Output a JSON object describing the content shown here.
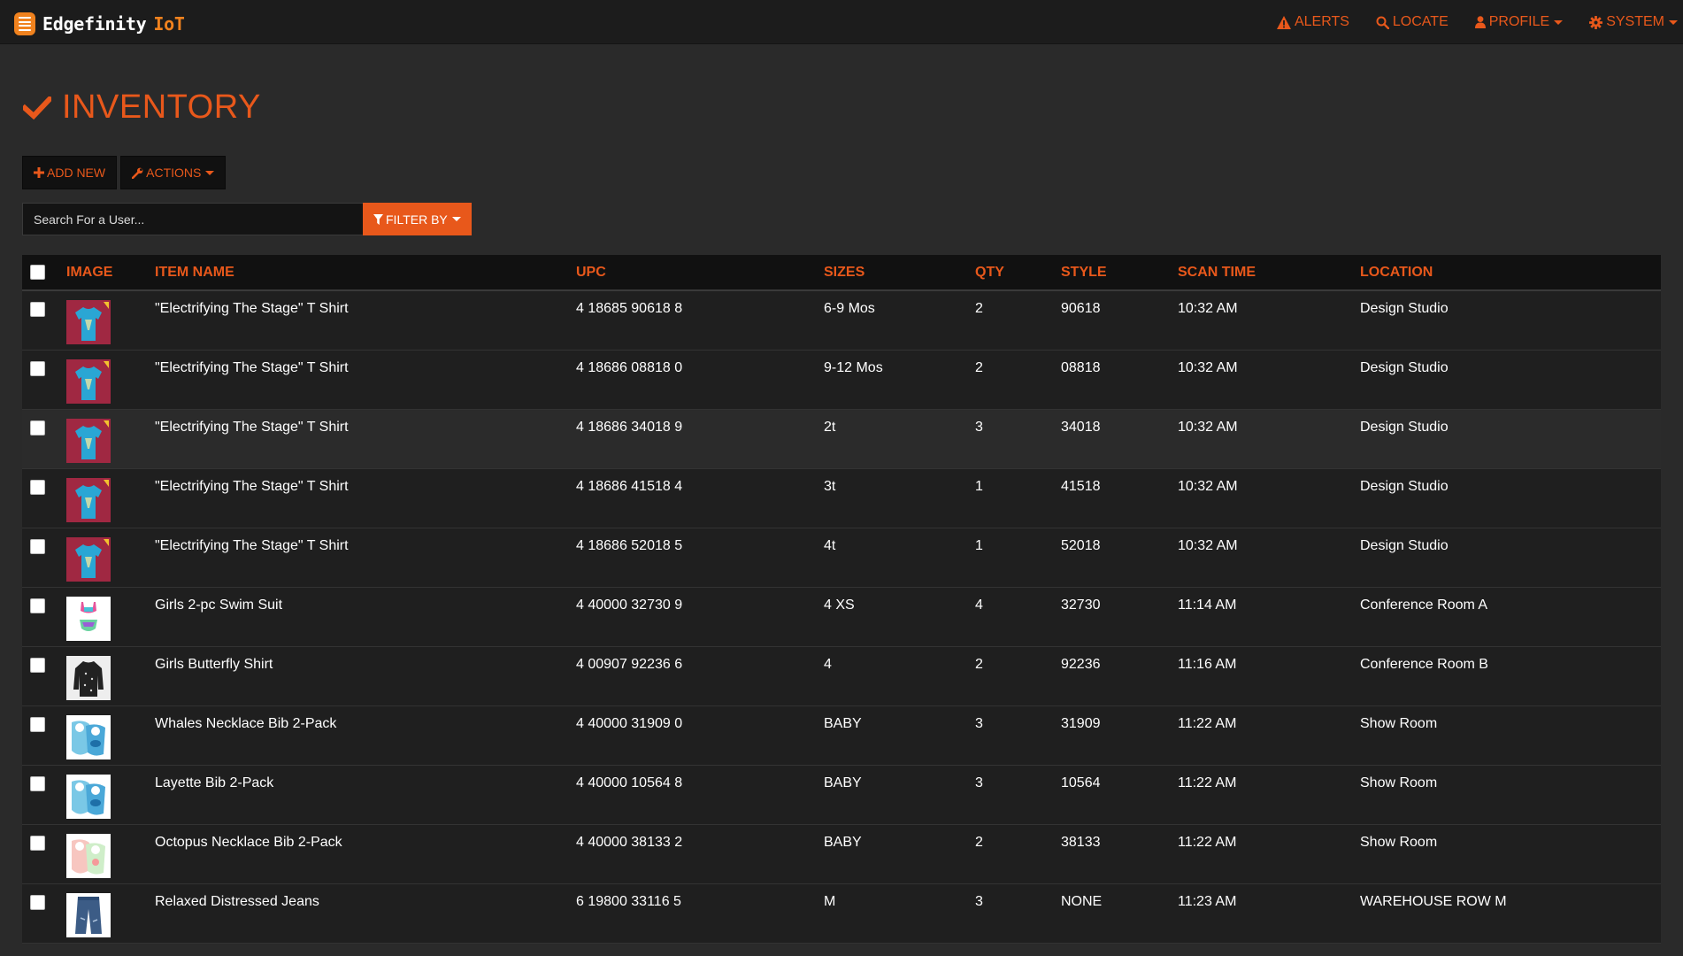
{
  "brand": {
    "name": "Edgefinity",
    "suffix": "IoT",
    "accent": "#f0821e"
  },
  "nav": {
    "alerts": "ALERTS",
    "locate": "LOCATE",
    "profile": "PROFILE",
    "system": "SYSTEM"
  },
  "page": {
    "title": "INVENTORY",
    "accent": "#e8581b"
  },
  "toolbar": {
    "add_new": "ADD NEW",
    "actions": "ACTIONS"
  },
  "search": {
    "placeholder": "Search For a User...",
    "filter_label": "FILTER BY"
  },
  "table": {
    "columns": {
      "image": "IMAGE",
      "item_name": "ITEM NAME",
      "upc": "UPC",
      "sizes": "SIZES",
      "qty": "QTY",
      "style": "STYLE",
      "scan_time": "SCAN TIME",
      "location": "LOCATION"
    },
    "rows": [
      {
        "thumb": "tshirt",
        "name": "\"Electrifying The Stage\" T Shirt",
        "upc": "4 18685 90618 8",
        "size": "6-9 Mos",
        "qty": "2",
        "style": "90618",
        "time": "10:32 AM",
        "location": "Design Studio"
      },
      {
        "thumb": "tshirt",
        "name": "\"Electrifying The Stage\" T Shirt",
        "upc": "4 18686 08818 0",
        "size": "9-12 Mos",
        "qty": "2",
        "style": "08818",
        "time": "10:32 AM",
        "location": "Design Studio"
      },
      {
        "thumb": "tshirt",
        "name": "\"Electrifying The Stage\" T Shirt",
        "upc": "4 18686 34018 9",
        "size": "2t",
        "qty": "3",
        "style": "34018",
        "time": "10:32 AM",
        "location": "Design Studio"
      },
      {
        "thumb": "tshirt",
        "name": "\"Electrifying The Stage\" T Shirt",
        "upc": "4 18686 41518 4",
        "size": "3t",
        "qty": "1",
        "style": "41518",
        "time": "10:32 AM",
        "location": "Design Studio"
      },
      {
        "thumb": "tshirt",
        "name": "\"Electrifying The Stage\" T Shirt",
        "upc": "4 18686 52018 5",
        "size": "4t",
        "qty": "1",
        "style": "52018",
        "time": "10:32 AM",
        "location": "Design Studio"
      },
      {
        "thumb": "swimsuit",
        "name": "Girls 2-pc Swim Suit",
        "upc": "4 40000 32730 9",
        "size": "4 XS",
        "qty": "4",
        "style": "32730",
        "time": "11:14 AM",
        "location": "Conference Room A"
      },
      {
        "thumb": "shirt",
        "name": "Girls Butterfly Shirt",
        "upc": "4 00907 92236 6",
        "size": "4",
        "qty": "2",
        "style": "92236",
        "time": "11:16 AM",
        "location": "Conference Room B"
      },
      {
        "thumb": "bib-blue",
        "name": "Whales Necklace Bib 2-Pack",
        "upc": "4 40000 31909 0",
        "size": "BABY",
        "qty": "3",
        "style": "31909",
        "time": "11:22 AM",
        "location": "Show Room"
      },
      {
        "thumb": "bib-blue",
        "name": "Layette Bib 2-Pack",
        "upc": "4 40000 10564 8",
        "size": "BABY",
        "qty": "3",
        "style": "10564",
        "time": "11:22 AM",
        "location": "Show Room"
      },
      {
        "thumb": "bib-pink",
        "name": "Octopus Necklace Bib 2-Pack",
        "upc": "4 40000 38133 2",
        "size": "BABY",
        "qty": "2",
        "style": "38133",
        "time": "11:22 AM",
        "location": "Show Room"
      },
      {
        "thumb": "jeans",
        "name": "Relaxed Distressed Jeans",
        "upc": "6 19800 33116 5",
        "size": "M",
        "qty": "3",
        "style": "NONE",
        "time": "11:23 AM",
        "location": "WAREHOUSE ROW M"
      }
    ]
  }
}
